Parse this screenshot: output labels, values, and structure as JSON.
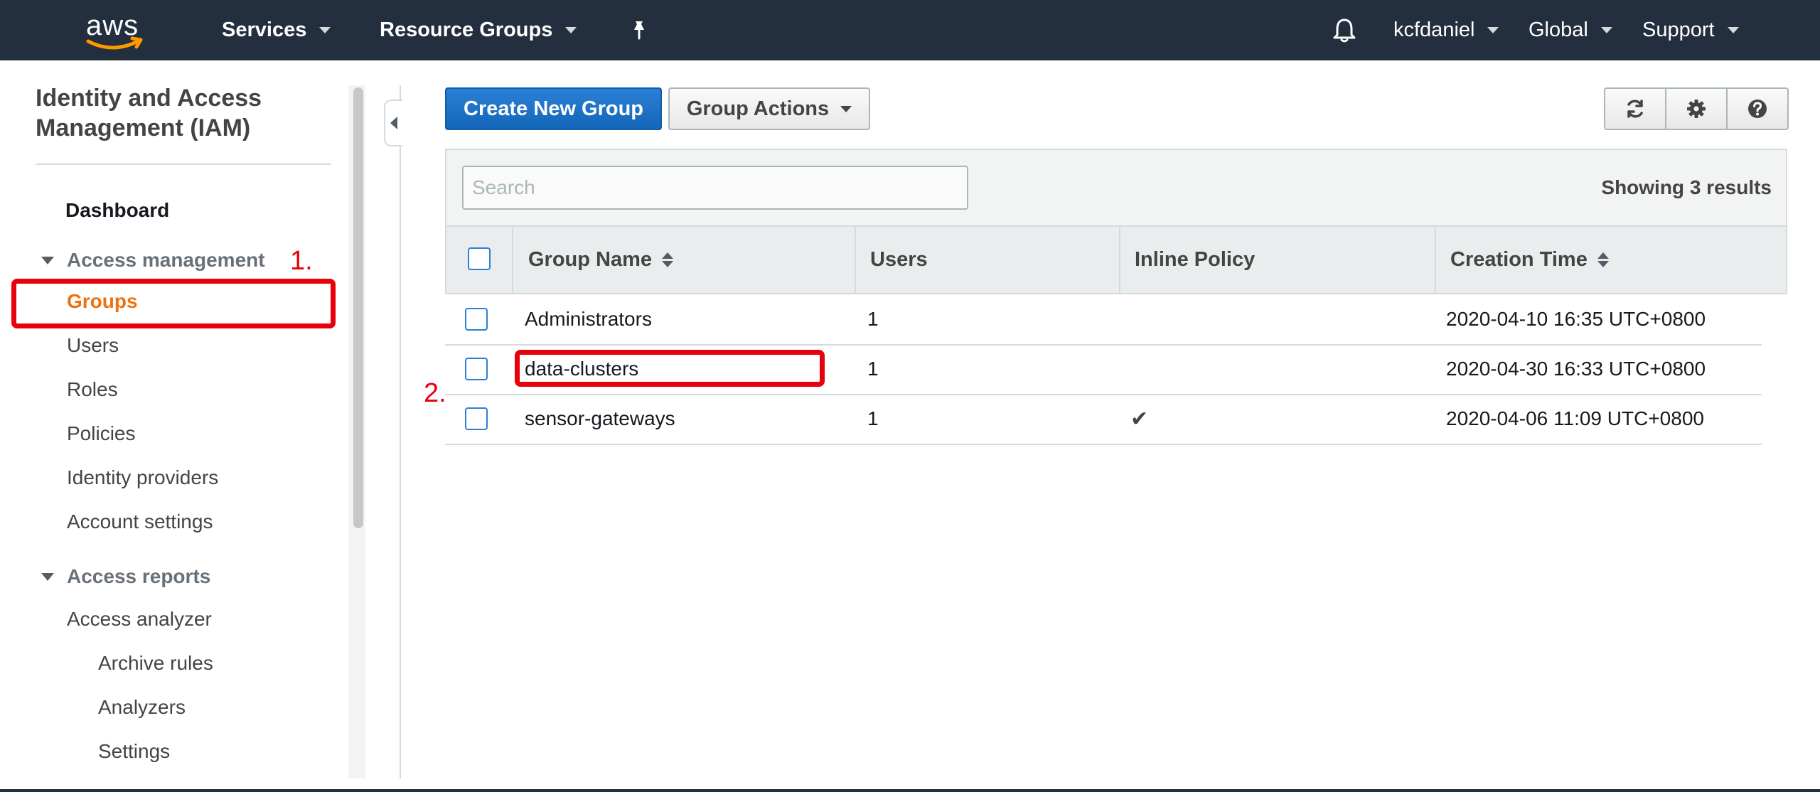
{
  "nav": {
    "logo": "aws",
    "services": "Services",
    "resource_groups": "Resource Groups",
    "pin_icon": "pin-icon",
    "bell_icon": "bell-icon",
    "account": "kcfdaniel",
    "region": "Global",
    "support": "Support"
  },
  "sidebar": {
    "title": "Identity and Access Management (IAM)",
    "dashboard": "Dashboard",
    "section_access_management": "Access management",
    "groups": "Groups",
    "users": "Users",
    "roles": "Roles",
    "policies": "Policies",
    "identity_providers": "Identity providers",
    "account_settings": "Account settings",
    "section_access_reports": "Access reports",
    "access_analyzer": "Access analyzer",
    "archive_rules": "Archive rules",
    "analyzers": "Analyzers",
    "settings": "Settings"
  },
  "toolbar": {
    "create_group": "Create New Group",
    "group_actions": "Group Actions",
    "icons": [
      "refresh-icon",
      "gear-icon",
      "help-icon"
    ]
  },
  "table": {
    "search_placeholder": "Search",
    "results": "Showing 3 results",
    "columns": {
      "group_name": "Group Name",
      "users": "Users",
      "inline_policy": "Inline Policy",
      "creation_time": "Creation Time"
    },
    "rows": [
      {
        "name": "Administrators",
        "users": "1",
        "inline_policy": "",
        "created": "2020-04-10 16:35 UTC+0800"
      },
      {
        "name": "data-clusters",
        "users": "1",
        "inline_policy": "",
        "created": "2020-04-30 16:33 UTC+0800"
      },
      {
        "name": "sensor-gateways",
        "users": "1",
        "inline_policy": "✔",
        "created": "2020-04-06 11:09 UTC+0800"
      }
    ]
  },
  "annotations": {
    "step1": "1.",
    "step2": "2."
  },
  "colors": {
    "nav_bg": "#232f3e",
    "primary_button": "#1f73c9",
    "active_link": "#ec7211",
    "annotation": "#e8000b"
  }
}
